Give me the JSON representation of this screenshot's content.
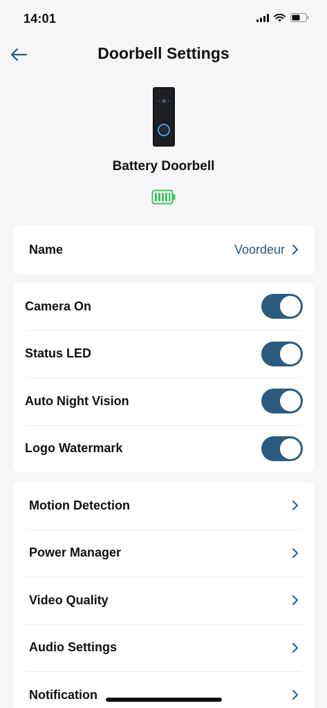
{
  "status_bar": {
    "time": "14:01"
  },
  "nav": {
    "title": "Doorbell Settings"
  },
  "device": {
    "name": "Battery Doorbell",
    "battery_color": "#3ec45a"
  },
  "name_card": {
    "label": "Name",
    "value": "Voordeur"
  },
  "toggles": [
    {
      "label": "Camera On",
      "on": true
    },
    {
      "label": "Status LED",
      "on": true
    },
    {
      "label": "Auto Night Vision",
      "on": true
    },
    {
      "label": "Logo Watermark",
      "on": true
    }
  ],
  "menu": [
    {
      "label": "Motion Detection"
    },
    {
      "label": "Power Manager"
    },
    {
      "label": "Video Quality"
    },
    {
      "label": "Audio Settings"
    },
    {
      "label": "Notification"
    }
  ],
  "colors": {
    "accent": "#2c5b80",
    "background": "#f6f6f8"
  }
}
